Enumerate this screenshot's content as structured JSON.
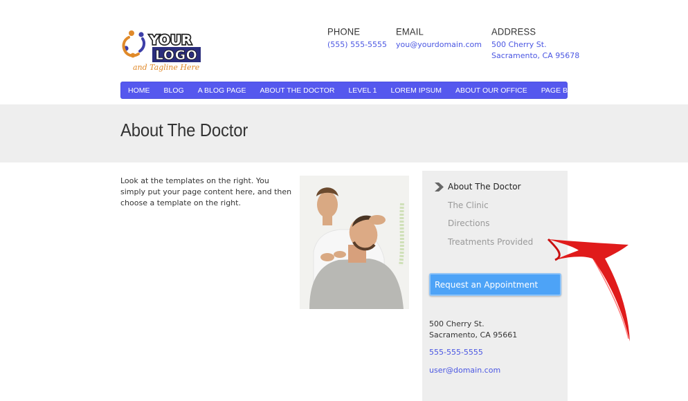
{
  "header": {
    "logo": {
      "line1": "YOUR",
      "line2": "LOGO",
      "tagline": "and Tagline Here"
    },
    "phone": {
      "heading": "PHONE",
      "value": "(555) 555-5555"
    },
    "email": {
      "heading": "EMAIL",
      "value": "you@yourdomain.com"
    },
    "address": {
      "heading": "ADDRESS",
      "line1": "500 Cherry St.",
      "line2": "Sacramento, CA 95678"
    }
  },
  "nav": {
    "items": [
      {
        "label": "HOME"
      },
      {
        "label": "BLOG"
      },
      {
        "label": "A BLOG PAGE"
      },
      {
        "label": "ABOUT THE DOCTOR"
      },
      {
        "label": "LEVEL 1"
      },
      {
        "label": "LOREM IPSUM"
      },
      {
        "label": "ABOUT OUR OFFICE"
      },
      {
        "label": "PAGE B"
      }
    ]
  },
  "page": {
    "title": "About The Doctor",
    "intro": "Look at the templates on the right. You simply put your page content here, and then choose a template on the right."
  },
  "sidebar": {
    "items": [
      {
        "label": "About The Doctor",
        "active": true
      },
      {
        "label": "The Clinic"
      },
      {
        "label": "Directions"
      },
      {
        "label": "Treatments Provided"
      }
    ],
    "button_label": "Request an Appointment",
    "address_line1": "500 Cherry St.",
    "address_line2": "Sacramento, CA 95661",
    "phone": "555-555-5555",
    "email": "user@domain.com"
  },
  "colors": {
    "nav_bg": "#5558ee",
    "link": "#4a56e2",
    "button": "#4da3f7",
    "band": "#eeeeee",
    "annotation_arrow": "#e01b1b"
  },
  "icons": {
    "active_marker": "chevron-right-icon",
    "annotation": "red-arrow"
  }
}
